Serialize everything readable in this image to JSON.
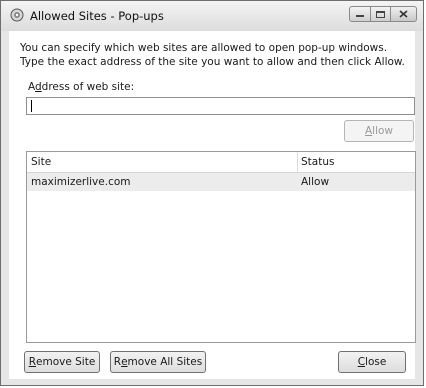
{
  "window": {
    "title": "Allowed Sites - Pop-ups",
    "controls": [
      "minimize-icon",
      "maximize-icon",
      "close-icon"
    ]
  },
  "description": "You can specify which web sites are allowed to open pop-up windows. Type the exact address of the site you want to allow and then click Allow.",
  "address": {
    "label_pre": "A",
    "label_accel": "d",
    "label_post": "dress of web site:",
    "value": ""
  },
  "allow_button": {
    "label_accel": "A",
    "label_rest": "llow",
    "enabled": false
  },
  "table": {
    "columns": [
      "Site",
      "Status"
    ],
    "rows": [
      {
        "site": "maximizerlive.com",
        "status": "Allow"
      }
    ]
  },
  "buttons": {
    "remove_site_accel": "R",
    "remove_site_rest": "emove Site",
    "remove_all_pre": "R",
    "remove_all_accel": "e",
    "remove_all_rest": "move All Sites",
    "close_accel": "C",
    "close_rest": "lose"
  }
}
